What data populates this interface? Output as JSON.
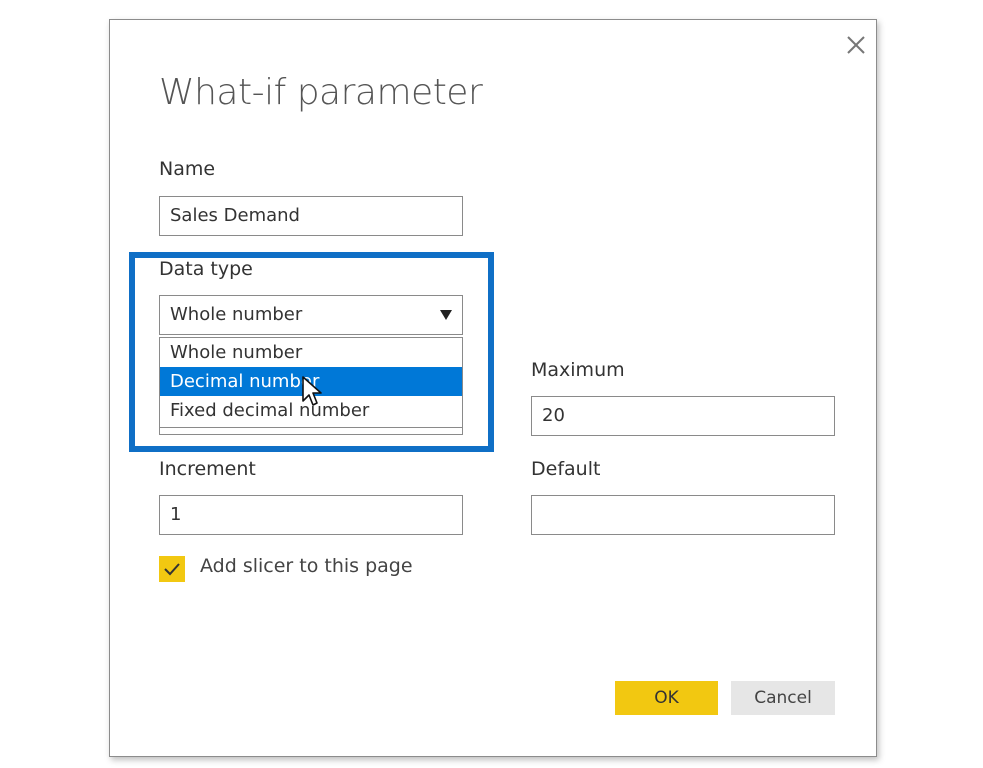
{
  "dialog": {
    "title": "What-if parameter",
    "close_icon": "close-icon"
  },
  "name": {
    "label": "Name",
    "value": "Sales Demand"
  },
  "data_type": {
    "label": "Data type",
    "selected": "Whole number",
    "options": [
      "Whole number",
      "Decimal number",
      "Fixed decimal number"
    ],
    "highlighted_option": "Decimal number"
  },
  "maximum": {
    "label": "Maximum",
    "value": "20"
  },
  "increment": {
    "label": "Increment",
    "value": "1"
  },
  "default": {
    "label": "Default",
    "value": ""
  },
  "slicer": {
    "label": "Add slicer to this page",
    "checked": true
  },
  "buttons": {
    "ok": "OK",
    "cancel": "Cancel"
  },
  "colors": {
    "accent_yellow": "#f2c811",
    "selection_blue": "#0078d7",
    "highlight_frame": "#0f6fc6"
  }
}
